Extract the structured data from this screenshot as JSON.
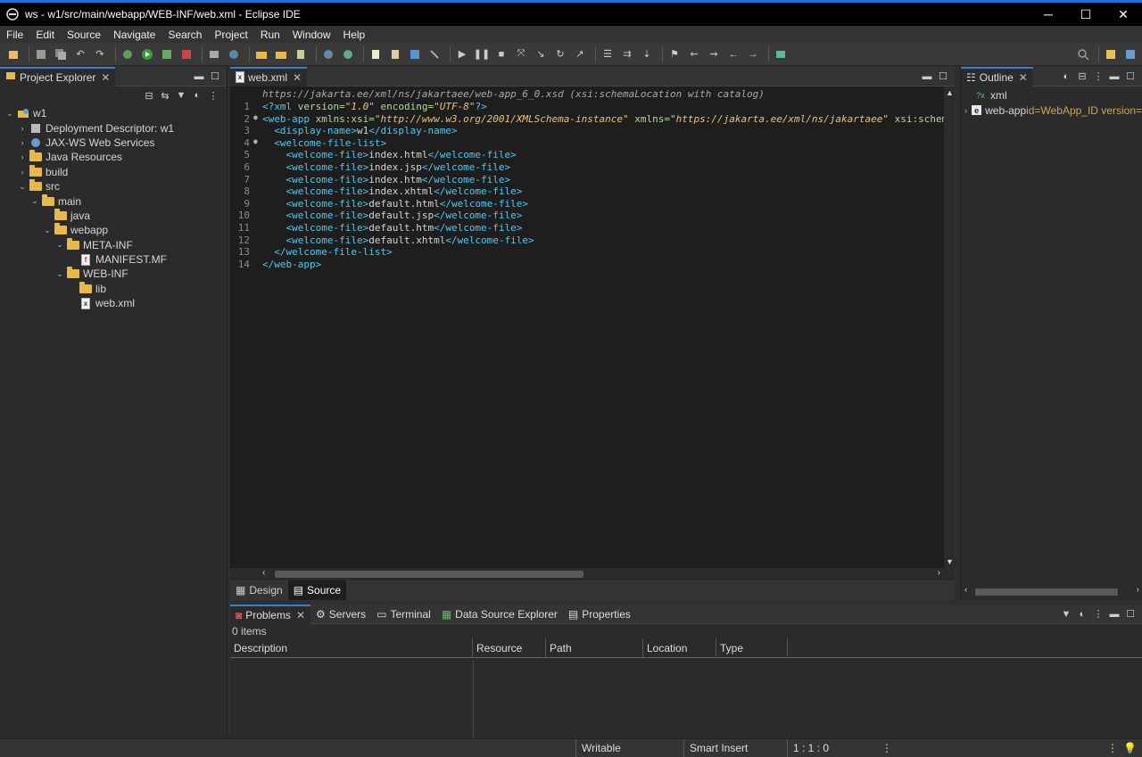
{
  "window": {
    "title": "ws - w1/src/main/webapp/WEB-INF/web.xml - Eclipse IDE",
    "minimize": "─",
    "maximize": "☐",
    "close": "✕"
  },
  "menu": [
    "File",
    "Edit",
    "Source",
    "Navigate",
    "Search",
    "Project",
    "Run",
    "Window",
    "Help"
  ],
  "explorer": {
    "tab_label": "Project Explorer",
    "tree": [
      {
        "depth": 0,
        "twisty": "⌄",
        "icon": "project",
        "label": "w1"
      },
      {
        "depth": 1,
        "twisty": "›",
        "icon": "descriptor",
        "label": "Deployment Descriptor: w1"
      },
      {
        "depth": 1,
        "twisty": "›",
        "icon": "service",
        "label": "JAX-WS Web Services"
      },
      {
        "depth": 1,
        "twisty": "›",
        "icon": "java-res",
        "label": "Java Resources"
      },
      {
        "depth": 1,
        "twisty": "›",
        "icon": "folder",
        "label": "build"
      },
      {
        "depth": 1,
        "twisty": "⌄",
        "icon": "folder",
        "label": "src"
      },
      {
        "depth": 2,
        "twisty": "⌄",
        "icon": "folder",
        "label": "main"
      },
      {
        "depth": 3,
        "twisty": "",
        "icon": "folder",
        "label": "java"
      },
      {
        "depth": 3,
        "twisty": "⌄",
        "icon": "folder",
        "label": "webapp"
      },
      {
        "depth": 4,
        "twisty": "⌄",
        "icon": "folder",
        "label": "META-INF"
      },
      {
        "depth": 5,
        "twisty": "",
        "icon": "mf-file",
        "label": "MANIFEST.MF"
      },
      {
        "depth": 4,
        "twisty": "⌄",
        "icon": "folder",
        "label": "WEB-INF"
      },
      {
        "depth": 5,
        "twisty": "",
        "icon": "folder",
        "label": "lib"
      },
      {
        "depth": 5,
        "twisty": "",
        "icon": "xml-file",
        "label": "web.xml"
      }
    ]
  },
  "editor": {
    "tab_label": "web.xml",
    "schema_hint": "https://jakarta.ee/xml/ns/jakartaee/web-app_6_0.xsd (xsi:schemaLocation with catalog)",
    "lines": [
      {
        "n": "1",
        "fold": "",
        "segs": [
          [
            "pi",
            "<?xml "
          ],
          [
            "attr",
            "version="
          ],
          [
            "val",
            "\"1.0\""
          ],
          [
            "attr",
            " encoding="
          ],
          [
            "val",
            "\"UTF-8\""
          ],
          [
            "pi",
            "?>"
          ]
        ]
      },
      {
        "n": "2",
        "fold": "●",
        "segs": [
          [
            "tag",
            "<web-app "
          ],
          [
            "attr",
            "xmlns:xsi="
          ],
          [
            "val",
            "\"http://www.w3.org/2001/XMLSchema-instance\""
          ],
          [
            "attr",
            " xmlns="
          ],
          [
            "val",
            "\"https://jakarta.ee/xml/ns/jakartaee\""
          ],
          [
            "attr",
            " xsi:schemaL"
          ]
        ]
      },
      {
        "n": "3",
        "fold": "",
        "segs": [
          [
            "txt",
            "  "
          ],
          [
            "tag",
            "<display-name>"
          ],
          [
            "txt",
            "w1"
          ],
          [
            "tag",
            "</display-name>"
          ]
        ]
      },
      {
        "n": "4",
        "fold": "●",
        "segs": [
          [
            "txt",
            "  "
          ],
          [
            "tag",
            "<welcome-file-list>"
          ]
        ]
      },
      {
        "n": "5",
        "fold": "",
        "segs": [
          [
            "txt",
            "    "
          ],
          [
            "tag",
            "<welcome-file>"
          ],
          [
            "txt",
            "index.html"
          ],
          [
            "tag",
            "</welcome-file>"
          ]
        ]
      },
      {
        "n": "6",
        "fold": "",
        "segs": [
          [
            "txt",
            "    "
          ],
          [
            "tag",
            "<welcome-file>"
          ],
          [
            "txt",
            "index.jsp"
          ],
          [
            "tag",
            "</welcome-file>"
          ]
        ]
      },
      {
        "n": "7",
        "fold": "",
        "segs": [
          [
            "txt",
            "    "
          ],
          [
            "tag",
            "<welcome-file>"
          ],
          [
            "txt",
            "index.htm"
          ],
          [
            "tag",
            "</welcome-file>"
          ]
        ]
      },
      {
        "n": "8",
        "fold": "",
        "segs": [
          [
            "txt",
            "    "
          ],
          [
            "tag",
            "<welcome-file>"
          ],
          [
            "txt",
            "index.xhtml"
          ],
          [
            "tag",
            "</welcome-file>"
          ]
        ]
      },
      {
        "n": "9",
        "fold": "",
        "segs": [
          [
            "txt",
            "    "
          ],
          [
            "tag",
            "<welcome-file>"
          ],
          [
            "txt",
            "default.html"
          ],
          [
            "tag",
            "</welcome-file>"
          ]
        ]
      },
      {
        "n": "10",
        "fold": "",
        "segs": [
          [
            "txt",
            "    "
          ],
          [
            "tag",
            "<welcome-file>"
          ],
          [
            "txt",
            "default.jsp"
          ],
          [
            "tag",
            "</welcome-file>"
          ]
        ]
      },
      {
        "n": "11",
        "fold": "",
        "segs": [
          [
            "txt",
            "    "
          ],
          [
            "tag",
            "<welcome-file>"
          ],
          [
            "txt",
            "default.htm"
          ],
          [
            "tag",
            "</welcome-file>"
          ]
        ]
      },
      {
        "n": "12",
        "fold": "",
        "segs": [
          [
            "txt",
            "    "
          ],
          [
            "tag",
            "<welcome-file>"
          ],
          [
            "txt",
            "default.xhtml"
          ],
          [
            "tag",
            "</welcome-file>"
          ]
        ]
      },
      {
        "n": "13",
        "fold": "",
        "segs": [
          [
            "txt",
            "  "
          ],
          [
            "tag",
            "</welcome-file-list>"
          ]
        ]
      },
      {
        "n": "14",
        "fold": "",
        "segs": [
          [
            "tag",
            "</web-app>"
          ]
        ]
      }
    ],
    "bottom_tabs": [
      "Design",
      "Source"
    ],
    "active_bottom_tab": "Source"
  },
  "outline": {
    "tab_label": "Outline",
    "items": [
      {
        "icon": "?x",
        "label": "xml",
        "extra": ""
      },
      {
        "icon": "e",
        "label": "web-app",
        "extra": " id=WebApp_ID version="
      }
    ]
  },
  "bottom_panel": {
    "tabs": [
      "Problems",
      "Servers",
      "Terminal",
      "Data Source Explorer",
      "Properties"
    ],
    "active_tab": "Problems",
    "items_count": "0 items",
    "columns": [
      "Description",
      "Resource",
      "Path",
      "Location",
      "Type"
    ]
  },
  "status": {
    "writable": "Writable",
    "insert_mode": "Smart Insert",
    "position": "1 : 1 : 0"
  },
  "colors": {
    "accent": "#3d7dca",
    "tag": "#4ec9f0",
    "attr": "#b8d7a3",
    "value": "#e6c47d"
  }
}
